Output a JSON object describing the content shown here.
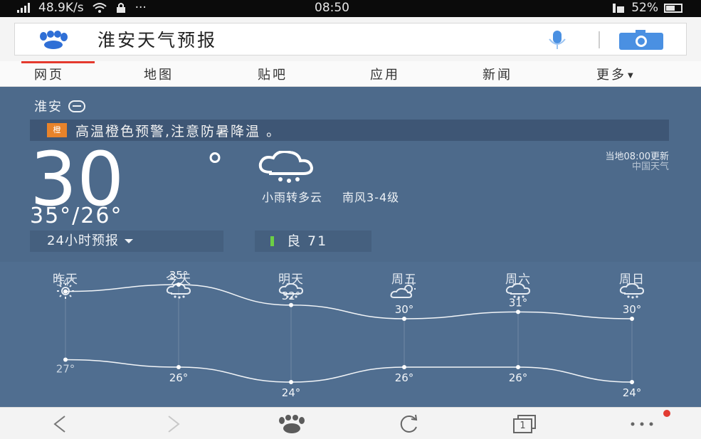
{
  "status_bar": {
    "net_speed": "48.9K/s",
    "more": "···",
    "time": "08:50",
    "battery": "52%"
  },
  "search": {
    "query": "淮安天气预报"
  },
  "tabs": [
    {
      "label": "网页"
    },
    {
      "label": "地图"
    },
    {
      "label": "贴吧"
    },
    {
      "label": "应用"
    },
    {
      "label": "新闻"
    },
    {
      "label": "更多"
    }
  ],
  "weather": {
    "city": "淮安",
    "alert_badge": "橙",
    "alert": "高温橙色预警,注意防暑降温 。",
    "current_temp": "30",
    "degree_symbol": "°",
    "condition": "小雨转多云",
    "wind": "南风3-4级",
    "update_time": "当地08:00更新",
    "source": "中国天气",
    "range": "35°/26°",
    "forecast_button": "24小时预报",
    "aqi": "良 71"
  },
  "forecast": {
    "days": [
      {
        "label": "昨天",
        "icon": "sun-icon",
        "high": "34°",
        "low": "27°"
      },
      {
        "label": "今天",
        "icon": "rain-cloud-icon",
        "high": "35°",
        "low": "26°"
      },
      {
        "label": "明天",
        "icon": "rain-cloud-icon",
        "high": "32°",
        "low": "24°"
      },
      {
        "label": "周五",
        "icon": "partly-cloudy-icon",
        "high": "30°",
        "low": "26°"
      },
      {
        "label": "周六",
        "icon": "rain-cloud-icon",
        "high": "31°",
        "low": "26°"
      },
      {
        "label": "周日",
        "icon": "rain-cloud-icon",
        "high": "30°",
        "low": "24°"
      }
    ]
  },
  "chart_data": {
    "type": "line",
    "categories": [
      "昨天",
      "今天",
      "明天",
      "周五",
      "周六",
      "周日"
    ],
    "series": [
      {
        "values": [
          34,
          35,
          32,
          30,
          31,
          30
        ]
      },
      {
        "values": [
          27,
          26,
          24,
          26,
          26,
          24
        ]
      }
    ]
  },
  "bottom_nav": {
    "tab_count": "1"
  }
}
